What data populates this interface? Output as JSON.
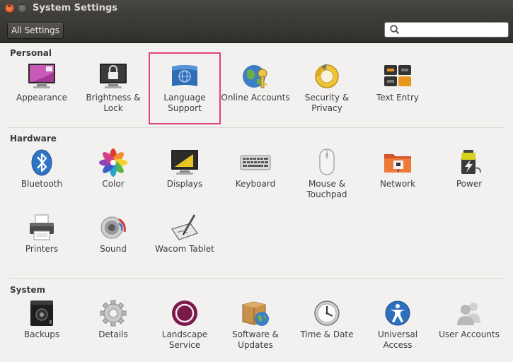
{
  "window": {
    "title": "System Settings"
  },
  "toolbar": {
    "all_settings_label": "All Settings",
    "search_value": "",
    "search_placeholder": ""
  },
  "sections": {
    "personal": {
      "title": "Personal",
      "items": [
        {
          "label": "Appearance",
          "icon": "appearance-icon"
        },
        {
          "label": "Brightness & Lock",
          "icon": "brightness-lock-icon"
        },
        {
          "label": "Language Support",
          "icon": "language-support-icon"
        },
        {
          "label": "Online Accounts",
          "icon": "online-accounts-icon"
        },
        {
          "label": "Security & Privacy",
          "icon": "security-privacy-icon"
        },
        {
          "label": "Text Entry",
          "icon": "text-entry-icon"
        }
      ]
    },
    "hardware": {
      "title": "Hardware",
      "items": [
        {
          "label": "Bluetooth",
          "icon": "bluetooth-icon"
        },
        {
          "label": "Color",
          "icon": "color-icon"
        },
        {
          "label": "Displays",
          "icon": "displays-icon"
        },
        {
          "label": "Keyboard",
          "icon": "keyboard-icon"
        },
        {
          "label": "Mouse & Touchpad",
          "icon": "mouse-touchpad-icon"
        },
        {
          "label": "Network",
          "icon": "network-icon"
        },
        {
          "label": "Power",
          "icon": "power-icon"
        },
        {
          "label": "Printers",
          "icon": "printers-icon"
        },
        {
          "label": "Sound",
          "icon": "sound-icon"
        },
        {
          "label": "Wacom Tablet",
          "icon": "wacom-tablet-icon"
        }
      ]
    },
    "system": {
      "title": "System",
      "items": [
        {
          "label": "Backups",
          "icon": "backups-icon"
        },
        {
          "label": "Details",
          "icon": "details-icon"
        },
        {
          "label": "Landscape Service",
          "icon": "landscape-service-icon"
        },
        {
          "label": "Software & Updates",
          "icon": "software-updates-icon"
        },
        {
          "label": "Time & Date",
          "icon": "time-date-icon"
        },
        {
          "label": "Universal Access",
          "icon": "universal-access-icon"
        },
        {
          "label": "User Accounts",
          "icon": "user-accounts-icon"
        }
      ]
    }
  },
  "colors": {
    "highlight": "#e0457a",
    "titlebar": "#3c3b37",
    "background": "#f2f1f0"
  }
}
